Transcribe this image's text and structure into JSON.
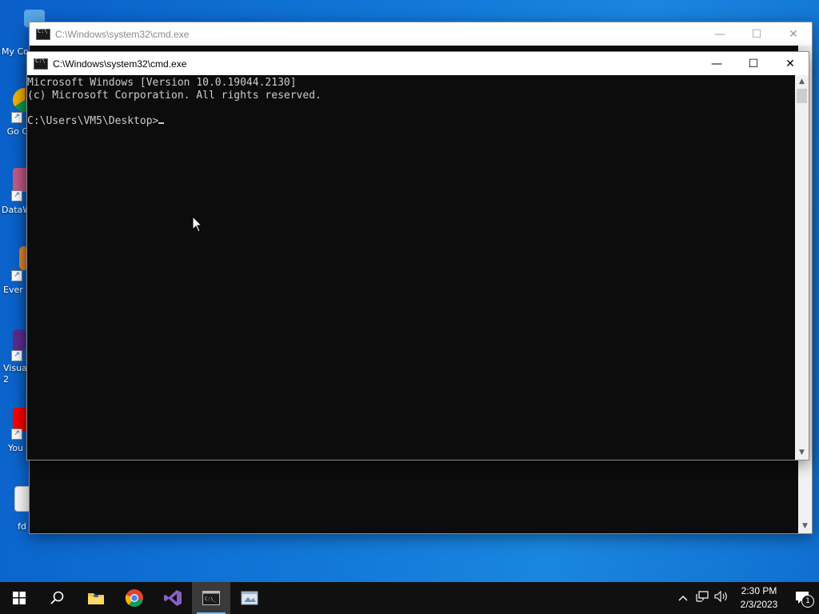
{
  "desktop": {
    "icons": [
      {
        "label": "My Co",
        "icon": "computer-icon"
      },
      {
        "label": "Go Ch",
        "icon": "chrome-icon"
      },
      {
        "label": "DataW",
        "icon": "datawrapper-icon"
      },
      {
        "label": "Ever",
        "icon": "evernote-icon"
      },
      {
        "label": "Visua 2",
        "icon": "visual-studio-icon"
      },
      {
        "label": "You",
        "icon": "youtube-icon"
      },
      {
        "label": "fd",
        "icon": "file-icon"
      }
    ]
  },
  "back_window": {
    "title": "C:\\Windows\\system32\\cmd.exe"
  },
  "front_window": {
    "title": "C:\\Windows\\system32\\cmd.exe",
    "console_lines": [
      "Microsoft Windows [Version 10.0.19044.2130]",
      "(c) Microsoft Corporation. All rights reserved.",
      ""
    ],
    "prompt": "C:\\Users\\VM5\\Desktop>"
  },
  "caption": {
    "minimize": "—",
    "maximize": "☐",
    "close": "✕"
  },
  "taskbar": {
    "apps": [
      "start-icon",
      "search-icon",
      "file-explorer-icon",
      "chrome-icon",
      "visual-studio-icon",
      "cmd-icon",
      "app-icon"
    ],
    "tray_chevron": "^",
    "time": "2:30 PM",
    "date": "2/3/2023",
    "notification_count": "1"
  },
  "colors": {
    "console_bg": "#0c0c0c",
    "console_text": "#cccccc",
    "taskbar_bg": "#101010",
    "accent": "#76b9ed"
  }
}
